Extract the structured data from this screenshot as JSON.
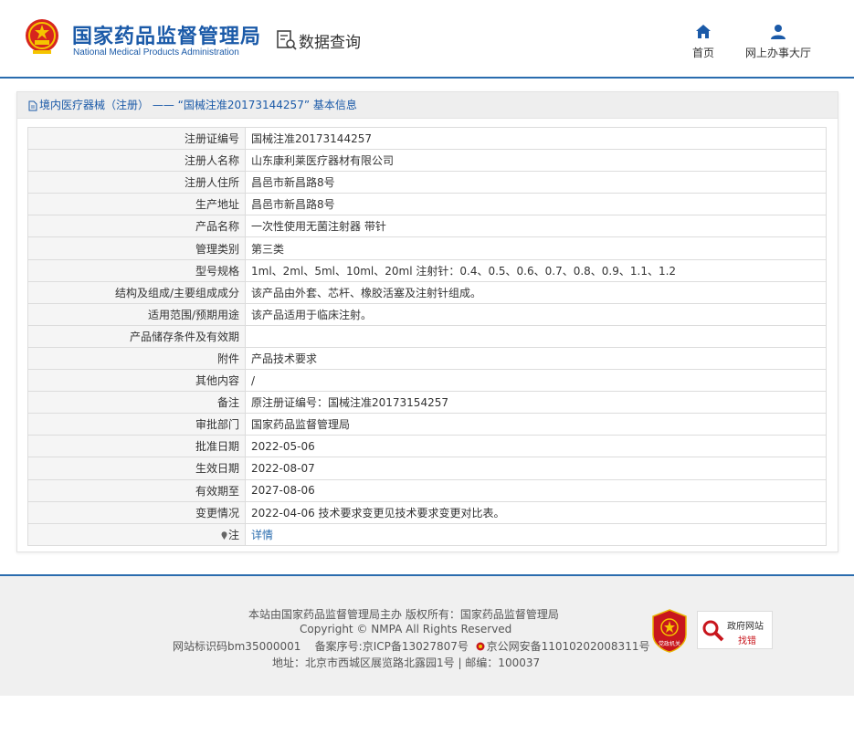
{
  "header": {
    "brand_cn": "国家药品监督管理局",
    "brand_en": "National Medical Products Administration",
    "db_title": "数据查询",
    "nav": {
      "home_label": "首页",
      "hall_label": "网上办事大厅"
    },
    "accent": "#1b5aa8"
  },
  "panel": {
    "title": "境内医疗器械（注册） —— “国械注准20173144257” 基本信息",
    "rows": [
      {
        "key": "注册证编号",
        "value": "国械注准20173144257"
      },
      {
        "key": "注册人名称",
        "value": "山东康利莱医疗器材有限公司"
      },
      {
        "key": "注册人住所",
        "value": "昌邑市新昌路8号"
      },
      {
        "key": "生产地址",
        "value": "昌邑市新昌路8号"
      },
      {
        "key": "产品名称",
        "value": "一次性使用无菌注射器 带针"
      },
      {
        "key": "管理类别",
        "value": "第三类"
      },
      {
        "key": "型号规格",
        "value": "1ml、2ml、5ml、10ml、20ml 注射针：0.4、0.5、0.6、0.7、0.8、0.9、1.1、1.2"
      },
      {
        "key": "结构及组成/主要组成成分",
        "value": "该产品由外套、芯杆、橡胶活塞及注射针组成。"
      },
      {
        "key": "适用范围/预期用途",
        "value": "该产品适用于临床注射。"
      },
      {
        "key": "产品储存条件及有效期",
        "value": ""
      },
      {
        "key": "附件",
        "value": "产品技术要求"
      },
      {
        "key": "其他内容",
        "value": "/"
      },
      {
        "key": "备注",
        "value": "原注册证编号：国械注准20173154257"
      },
      {
        "key": "审批部门",
        "value": "国家药品监督管理局"
      },
      {
        "key": "批准日期",
        "value": "2022-05-06"
      },
      {
        "key": "生效日期",
        "value": "2022-08-07"
      },
      {
        "key": "有效期至",
        "value": "2027-08-06"
      },
      {
        "key": "变更情况",
        "value": "2022-04-06 技术要求变更见技术要求变更对比表。"
      }
    ],
    "note": {
      "key": "注",
      "link_text": "详情"
    }
  },
  "footer": {
    "line1": "本站由国家药品监督管理局主办 版权所有：国家药品监督管理局",
    "line2": "Copyright © NMPA All Rights Reserved",
    "site_id": "网站标识码bm35000001",
    "icp": "备案序号:京ICP备13027807号",
    "police": "京公网安备11010202008311号",
    "address": "地址：北京市西城区展览路北露园1号 | 邮编：100037",
    "badge_red_text": "党政机关",
    "gov_badge_line1": "政府网站",
    "gov_badge_line2": "找错"
  }
}
